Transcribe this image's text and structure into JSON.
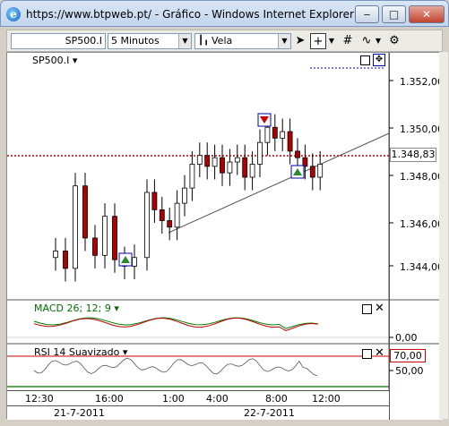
{
  "window": {
    "title": "https://www.btpweb.pt/ - Gráfico - Windows Internet Explorer",
    "minimize": "‒",
    "maximize": "□",
    "close": "✕"
  },
  "toolbar": {
    "symbol": "SP500.I",
    "interval": "5 Minutos",
    "chart_type": "Vela"
  },
  "main_panel": {
    "label": "SP500.I",
    "price_tag": "1.348,83",
    "y_ticks": [
      "1.352,00",
      "1.350,00",
      "1.348,00",
      "1.346,00",
      "1.344,00"
    ]
  },
  "macd_panel": {
    "label": "MACD 26; 12; 9",
    "y_tick": "0,00"
  },
  "rsi_panel": {
    "label": "RSI 14 Suavizado",
    "level_tag": "70,00",
    "y_tick": "50,00"
  },
  "time_axis": [
    "12:30",
    "16:00",
    "1:00",
    "4:00",
    "8:00",
    "12:00"
  ],
  "date_axis": [
    "21-7-2011",
    "22-7-2011"
  ],
  "colors": {
    "up": "#ffffff",
    "down": "#b00000",
    "macd": "#008000",
    "signal": "#c00000",
    "price_line": "#c00000"
  },
  "chart_data": {
    "type": "candlestick",
    "series": [
      {
        "name": "SP500.I",
        "values": [
          1344.6,
          1343.8,
          1347.6,
          1345.2,
          1344.4,
          1346.2,
          1344.2,
          1343.9,
          1344.3,
          1347.3,
          1346.5,
          1346.0,
          1345.7,
          1346.8,
          1347.5,
          1348.6,
          1349.0,
          1348.5,
          1348.9,
          1348.2,
          1348.7,
          1348.9,
          1348.0,
          1348.6,
          1349.6,
          1350.3,
          1349.8,
          1350.1,
          1349.2,
          1348.9,
          1348.5,
          1348.0,
          1348.6
        ]
      }
    ],
    "ylim": [
      1342.6,
      1353.4
    ],
    "annotations": [
      "sell-signal",
      "buy-signal",
      "buy-signal"
    ]
  }
}
